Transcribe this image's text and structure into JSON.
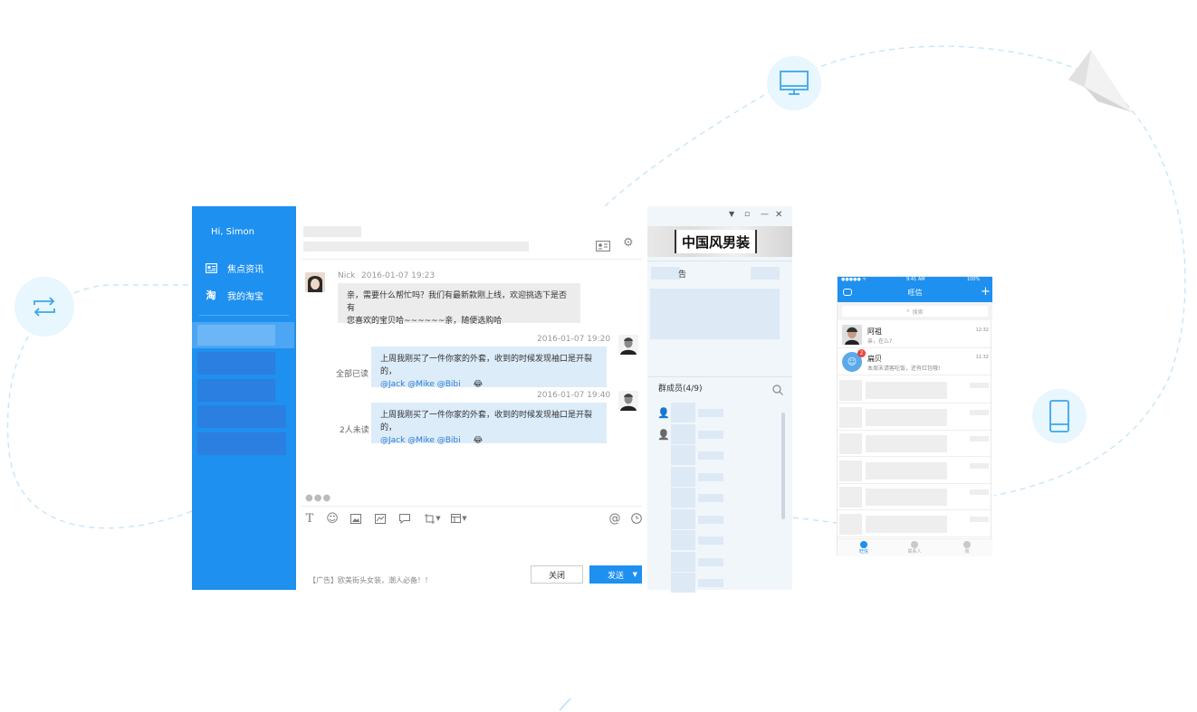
{
  "sidebar": {
    "greeting": "Hi,  Simon",
    "items": [
      {
        "label": "焦点资讯",
        "icon": "news-icon"
      },
      {
        "label": "我的淘宝",
        "icon": "taobao-icon"
      }
    ]
  },
  "chat": {
    "messages": [
      {
        "sender": "Nick",
        "time": "2016-01-07  19:23",
        "line1": "亲，需要什么帮忙吗？我们有最新款刚上线，欢迎挑选下是否有",
        "line2": "您喜欢的宝贝哈~~~~~~亲，随便选购哈"
      },
      {
        "time": "2016-01-07  19:20",
        "line1": "上周我刚买了一件你家的外套，收到的时候发现袖口是开裂的，",
        "mentions": "@Jack @Mike @Bibi",
        "status": "全部已读"
      },
      {
        "time": "2016-01-07  19:40",
        "line1": "上周我刚买了一件你家的外套，收到的时候发现袖口是开裂的，",
        "mentions": "@Jack @Mike @Bibi",
        "status": "2人未读"
      }
    ],
    "ad": "【广告】欧美街头女装，潮人必备！！",
    "close_label": "关闭",
    "send_label": "发送"
  },
  "group": {
    "shop_name": "中国风男装",
    "tab_fragment": "告",
    "members_label": "群成员(4/9)"
  },
  "phone": {
    "status_time": "9:41 AM",
    "status_battery": "100%",
    "title": "旺信",
    "search_placeholder": "搜索",
    "contacts": [
      {
        "name": "阿祖",
        "preview": "亲，在么?",
        "time": "12:32"
      },
      {
        "name": "扁贝",
        "preview": "本周末请客吃饭，还有红包哦!",
        "time": "11:32",
        "badge": "2"
      }
    ],
    "tabs": [
      "旺信",
      "联系人",
      "我"
    ]
  },
  "colors": {
    "brand_blue": "#1e90f0",
    "bubble_out": "#dcecf9",
    "bubble_in": "#ececec"
  }
}
